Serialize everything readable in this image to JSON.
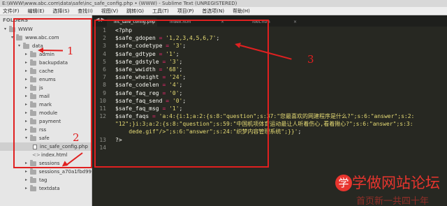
{
  "window": {
    "title": "E:\\WWW\\www.abc.com\\data\\safe\\inc_safe_config.php • (WWW) - Sublime Text (UNREGISTERED)"
  },
  "menu": [
    "文件(F)",
    "编辑(E)",
    "选择(S)",
    "查找(I)",
    "视图(V)",
    "跳转(G)",
    "工具(T)",
    "项目(P)",
    "首选项(N)",
    "帮助(H)"
  ],
  "sidebar": {
    "header": "FOLDERS",
    "items": [
      {
        "label": "WWW",
        "type": "folder",
        "depth": 0,
        "open": true
      },
      {
        "label": "www.abc.com",
        "type": "folder",
        "depth": 1,
        "open": true
      },
      {
        "label": "data",
        "type": "folder",
        "depth": 2,
        "open": true
      },
      {
        "label": "admin",
        "type": "folder",
        "depth": 3
      },
      {
        "label": "backupdata",
        "type": "folder",
        "depth": 3
      },
      {
        "label": "cache",
        "type": "folder",
        "depth": 3
      },
      {
        "label": "enums",
        "type": "folder",
        "depth": 3
      },
      {
        "label": "js",
        "type": "folder",
        "depth": 3
      },
      {
        "label": "mail",
        "type": "folder",
        "depth": 3
      },
      {
        "label": "mark",
        "type": "folder",
        "depth": 3
      },
      {
        "label": "module",
        "type": "folder",
        "depth": 3
      },
      {
        "label": "payment",
        "type": "folder",
        "depth": 3
      },
      {
        "label": "rss",
        "type": "folder",
        "depth": 3
      },
      {
        "label": "safe",
        "type": "folder",
        "depth": 3,
        "open": true
      },
      {
        "label": "inc_safe_config.php",
        "type": "file",
        "depth": 4,
        "selected": true
      },
      {
        "label": "index.html",
        "type": "html",
        "depth": 4
      },
      {
        "label": "sessions",
        "type": "folder",
        "depth": 3
      },
      {
        "label": "sessions_a70a1fbd99",
        "type": "folder",
        "depth": 3
      },
      {
        "label": "tag",
        "type": "folder",
        "depth": 3
      },
      {
        "label": "textdata",
        "type": "folder",
        "depth": 3
      }
    ]
  },
  "tabs": [
    {
      "label": "inc_safe_config.php",
      "active": true
    },
    {
      "label": "index.htm",
      "active": false
    },
    {
      "label": "foot.htm",
      "active": false
    }
  ],
  "code": {
    "line_numbers": [
      "1",
      "2",
      "3",
      "4",
      "5",
      "6",
      "7",
      "8",
      "9",
      "10",
      "11",
      "12",
      "",
      "",
      "13",
      "14"
    ],
    "lines": [
      [
        {
          "t": "<?php",
          "c": "tagc"
        }
      ],
      [
        {
          "t": "$safe_gdopen",
          "c": "var"
        },
        {
          "t": " = ",
          "c": "op"
        },
        {
          "t": "'1,2,3,4,5,6,7'",
          "c": "str"
        },
        {
          "t": ";",
          "c": "var"
        }
      ],
      [
        {
          "t": "$safe_codetype",
          "c": "var"
        },
        {
          "t": " = ",
          "c": "op"
        },
        {
          "t": "'3'",
          "c": "str"
        },
        {
          "t": ";",
          "c": "var"
        }
      ],
      [
        {
          "t": "$safe_gdtype",
          "c": "var"
        },
        {
          "t": " = ",
          "c": "op"
        },
        {
          "t": "'1'",
          "c": "str"
        },
        {
          "t": ";",
          "c": "var"
        }
      ],
      [
        {
          "t": "$safe_gdstyle",
          "c": "var"
        },
        {
          "t": " = ",
          "c": "op"
        },
        {
          "t": "'3'",
          "c": "str"
        },
        {
          "t": ";",
          "c": "var"
        }
      ],
      [
        {
          "t": "$safe_wwidth",
          "c": "var"
        },
        {
          "t": " = ",
          "c": "op"
        },
        {
          "t": "'68'",
          "c": "str"
        },
        {
          "t": ";",
          "c": "var"
        }
      ],
      [
        {
          "t": "$safe_wheight",
          "c": "var"
        },
        {
          "t": " = ",
          "c": "op"
        },
        {
          "t": "'24'",
          "c": "str"
        },
        {
          "t": ";",
          "c": "var"
        }
      ],
      [
        {
          "t": "$safe_codelen",
          "c": "var"
        },
        {
          "t": " = ",
          "c": "op"
        },
        {
          "t": "'4'",
          "c": "str"
        },
        {
          "t": ";",
          "c": "var"
        }
      ],
      [
        {
          "t": "$safe_faq_reg",
          "c": "var"
        },
        {
          "t": " = ",
          "c": "op"
        },
        {
          "t": "'0'",
          "c": "str"
        },
        {
          "t": ";",
          "c": "var"
        }
      ],
      [
        {
          "t": "$safe_faq_send",
          "c": "var"
        },
        {
          "t": " = ",
          "c": "op"
        },
        {
          "t": "'0'",
          "c": "str"
        },
        {
          "t": ";",
          "c": "var"
        }
      ],
      [
        {
          "t": "$safe_faq_msg",
          "c": "var"
        },
        {
          "t": " = ",
          "c": "op"
        },
        {
          "t": "'1'",
          "c": "str"
        },
        {
          "t": ";",
          "c": "var"
        }
      ],
      [
        {
          "t": "$safe_faqs",
          "c": "var"
        },
        {
          "t": " = ",
          "c": "op"
        },
        {
          "t": "'a:4:{i:1;a:2:{s:8:\"question\";s:37:\"您最喜欢的网建程序是什么?\";s:6:\"answer\";s:2:",
          "c": "str"
        }
      ],
      [
        {
          "t": "\"12\";}i:3;a:2:{s:8:\"question\";s:59:\"中国机项体育运动最让人听着伤心,看着揪心?\";s:6:\"answer\";s:3:",
          "c": "str"
        }
      ],
      [
        {
          "t": "    dede.gif\"/>\";s:6:\"answer\";s:24:\"织梦内容管理系统\";}}'",
          "c": "str"
        },
        {
          "t": ";",
          "c": "var"
        }
      ],
      [
        {
          "t": "?>",
          "c": "tagc"
        }
      ],
      [
        {
          "t": "",
          "c": "var"
        }
      ]
    ]
  },
  "annotations": [
    "1",
    "2",
    "3"
  ],
  "watermark": {
    "circle": "学",
    "text": "学做网站论坛",
    "sub": "首页新一共四十年"
  },
  "colors": {
    "annotation": "#e02020",
    "editor_bg": "#272822",
    "string": "#e6db74",
    "operator": "#f92672"
  }
}
